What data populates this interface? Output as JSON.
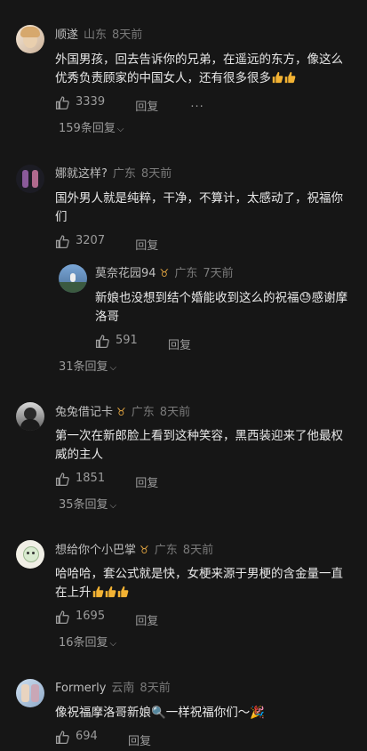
{
  "comments": [
    {
      "name": "顺遂",
      "location": "山东",
      "time": "8天前",
      "text": "外国男孩，回去告诉你的兄弟，在遥远的东方，像这么优秀负责顾家的中国女人，还有很多很多",
      "likes": "3339",
      "reply_label": "回复",
      "more_label": "···",
      "expand": "159条回复"
    },
    {
      "name": "娜就这样?",
      "location": "广东",
      "time": "8天前",
      "text": "国外男人就是纯粹，干净，不算计，太感动了，祝福你们",
      "likes": "3207",
      "reply_label": "回复",
      "expand": "31条回复",
      "subreply": {
        "name": "莫奈花园94",
        "location": "广东",
        "time": "7天前",
        "text": "新娘也没想到结个婚能收到这么的祝福😓感谢摩洛哥",
        "likes": "591",
        "reply_label": "回复"
      }
    },
    {
      "name": "兔兔借记卡",
      "location": "广东",
      "time": "8天前",
      "text": "第一次在新郎脸上看到这种笑容，黑西装迎来了他最权威的主人",
      "likes": "1851",
      "reply_label": "回复",
      "expand": "35条回复"
    },
    {
      "name": "想给你个小巴掌",
      "location": "广东",
      "time": "8天前",
      "text": "哈哈哈，套公式就是快，女梗来源于男梗的含金量一直在上升",
      "likes": "1695",
      "reply_label": "回复",
      "expand": "16条回复"
    },
    {
      "name": "Formerly",
      "location": "云南",
      "time": "8天前",
      "text": "像祝福摩洛哥新娘🔍一样祝福你们～🎉",
      "likes": "694",
      "reply_label": "回复"
    }
  ],
  "colors": {
    "background": "#161616",
    "text": "#e8e8e8",
    "meta": "#7a7a7a",
    "badge": "#e0a340",
    "thumb": "#f2b233"
  }
}
